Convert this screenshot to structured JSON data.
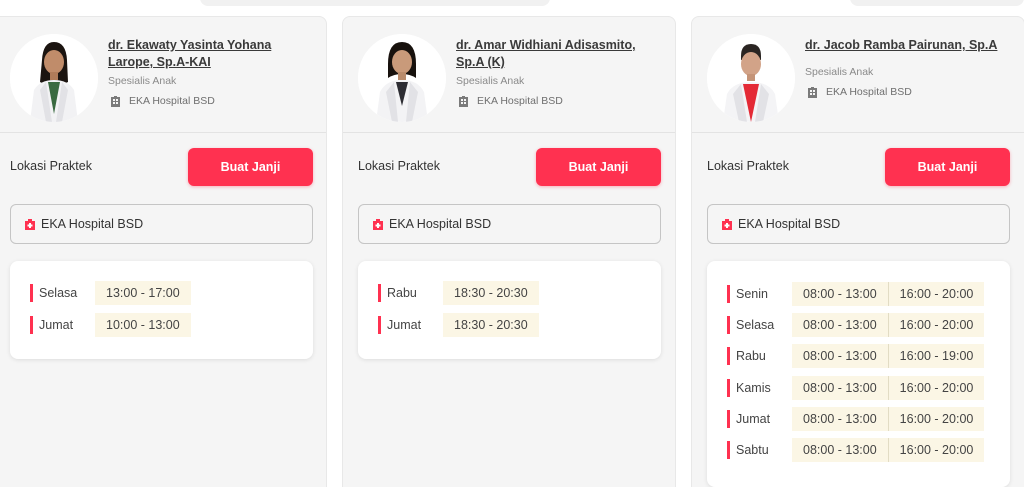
{
  "doctors": [
    {
      "name": "dr. Ekawaty Yasinta Yohana Larope, Sp.A-KAI",
      "specialty": "Spesialis Anak",
      "hospital": "EKA Hospital BSD",
      "location_label": "Lokasi Praktek",
      "button_label": "Buat Janji",
      "location": "EKA Hospital BSD",
      "schedule": [
        {
          "day": "Selasa",
          "times": [
            "13:00 - 17:00"
          ]
        },
        {
          "day": "Jumat",
          "times": [
            "10:00 - 13:00"
          ]
        }
      ]
    },
    {
      "name": "dr. Amar Widhiani Adisasmito, Sp.A (K)",
      "specialty": "Spesialis Anak",
      "hospital": "EKA Hospital BSD",
      "location_label": "Lokasi Praktek",
      "button_label": "Buat Janji",
      "location": "EKA Hospital BSD",
      "schedule": [
        {
          "day": "Rabu",
          "times": [
            "18:30 - 20:30"
          ]
        },
        {
          "day": "Jumat",
          "times": [
            "18:30 - 20:30"
          ]
        }
      ]
    },
    {
      "name": "dr. Jacob Ramba Pairunan, Sp.A",
      "specialty": "Spesialis Anak",
      "hospital": "EKA Hospital BSD",
      "location_label": "Lokasi Praktek",
      "button_label": "Buat Janji",
      "location": "EKA Hospital BSD",
      "schedule": [
        {
          "day": "Senin",
          "times": [
            "08:00 - 13:00",
            "16:00 - 20:00"
          ]
        },
        {
          "day": "Selasa",
          "times": [
            "08:00 - 13:00",
            "16:00 - 20:00"
          ]
        },
        {
          "day": "Rabu",
          "times": [
            "08:00 - 13:00",
            "16:00 - 19:00"
          ]
        },
        {
          "day": "Kamis",
          "times": [
            "08:00 - 13:00",
            "16:00 - 20:00"
          ]
        },
        {
          "day": "Jumat",
          "times": [
            "08:00 - 13:00",
            "16:00 - 20:00"
          ]
        },
        {
          "day": "Sabtu",
          "times": [
            "08:00 - 13:00",
            "16:00 - 20:00"
          ]
        }
      ]
    }
  ],
  "colors": {
    "accent": "#ff3150",
    "slot_bg": "#fbf6e5",
    "card_bg": "#f5f5f5"
  },
  "icons": {
    "hospital": "building-icon",
    "location": "hospital-icon"
  }
}
